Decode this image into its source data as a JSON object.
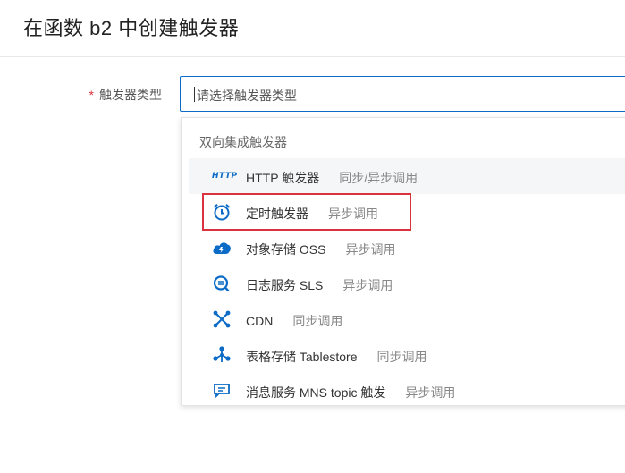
{
  "page": {
    "title": "在函数 b2 中创建触发器"
  },
  "form": {
    "required_mark": "*",
    "trigger_type_label": "触发器类型",
    "trigger_type_placeholder": "请选择触发器类型"
  },
  "dropdown": {
    "group_title": "双向集成触发器",
    "options": [
      {
        "name": "HTTP 触发器",
        "desc": "同步/异步调用",
        "icon": "http-icon"
      },
      {
        "name": "定时触发器",
        "desc": "异步调用",
        "icon": "alarm-clock-icon"
      },
      {
        "name": "对象存储 OSS",
        "desc": "异步调用",
        "icon": "cloud-icon"
      },
      {
        "name": "日志服务 SLS",
        "desc": "异步调用",
        "icon": "log-service-icon"
      },
      {
        "name": "CDN",
        "desc": "同步调用",
        "icon": "cdn-icon"
      },
      {
        "name": "表格存储 Tablestore",
        "desc": "同步调用",
        "icon": "tablestore-icon"
      },
      {
        "name": "消息服务 MNS topic 触发",
        "desc": "异步调用",
        "icon": "mns-icon"
      }
    ],
    "http_icon_text": "HTTP"
  },
  "colors": {
    "accent": "#0b6bc6",
    "highlight": "#d9333f",
    "required": "#d9333f"
  }
}
